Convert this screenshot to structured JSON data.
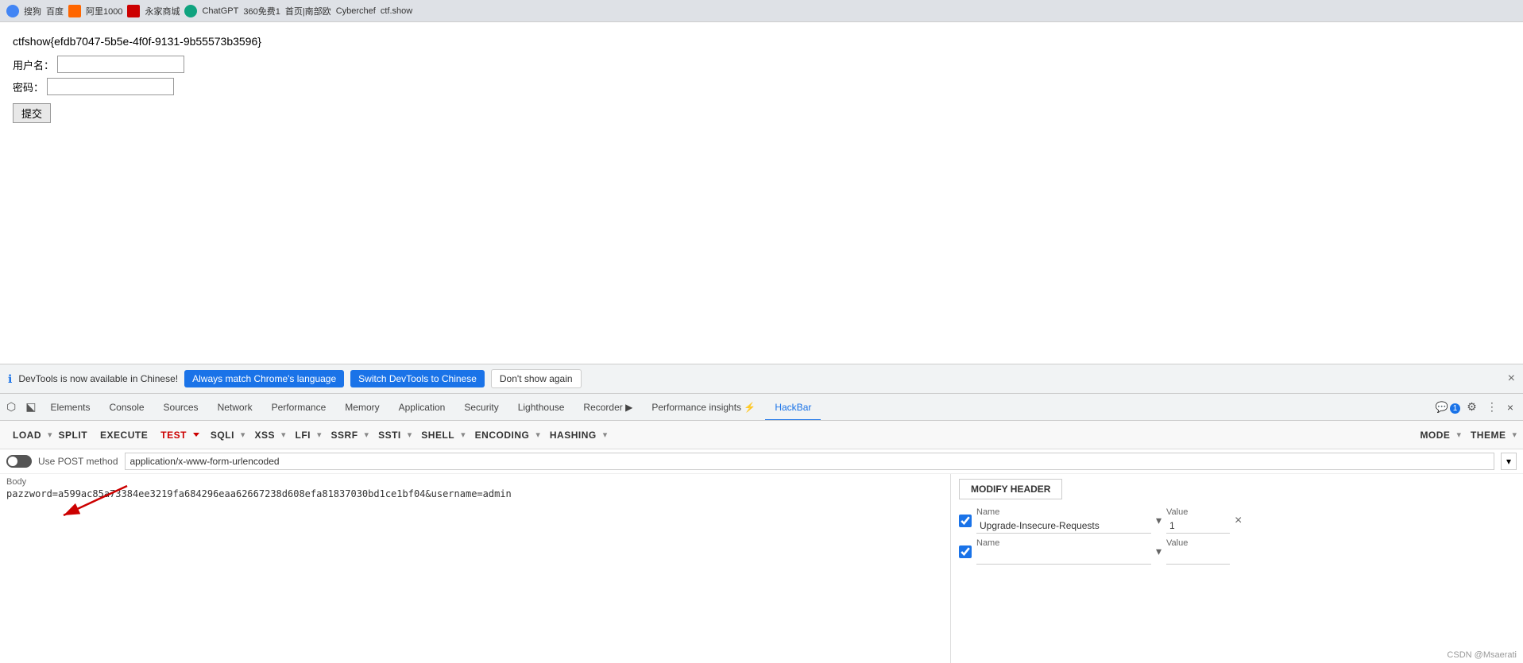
{
  "browser": {
    "topbar_items": [
      "搜狗",
      "百度",
      "阿里1000",
      "永家商城",
      "ChatGPT",
      "360免费1",
      "首页|南部欧",
      "Cyberchef",
      "ctf.show"
    ]
  },
  "page": {
    "ctf_flag": "ctfshow{efdb7047-5b5e-4f0f-9131-9b55573b3596}",
    "username_label": "用户名：",
    "password_label": "密码：",
    "submit_label": "提交"
  },
  "devtools_notification": {
    "icon": "ℹ",
    "message": "DevTools is now available in Chinese!",
    "btn1": "Always match Chrome's language",
    "btn2": "Switch DevTools to Chinese",
    "btn3": "Don't show again",
    "close": "×"
  },
  "devtools": {
    "tabs": [
      {
        "label": "Elements",
        "active": false
      },
      {
        "label": "Console",
        "active": false
      },
      {
        "label": "Sources",
        "active": false
      },
      {
        "label": "Network",
        "active": false
      },
      {
        "label": "Performance",
        "active": false
      },
      {
        "label": "Memory",
        "active": false
      },
      {
        "label": "Application",
        "active": false
      },
      {
        "label": "Security",
        "active": false
      },
      {
        "label": "Lighthouse",
        "active": false
      },
      {
        "label": "Recorder ▶",
        "active": false
      },
      {
        "label": "Performance insights ⚡",
        "active": false
      },
      {
        "label": "HackBar",
        "active": true
      }
    ],
    "notification_count": "1",
    "icons": {
      "inspect": "⬡",
      "device": "⬕",
      "gear": "⚙",
      "overflow": "⋮",
      "close": "×"
    }
  },
  "hackbar": {
    "buttons": [
      {
        "label": "LOAD",
        "has_dropdown": true
      },
      {
        "label": "SPLIT",
        "has_dropdown": false
      },
      {
        "label": "EXECUTE",
        "has_dropdown": false
      },
      {
        "label": "TEST",
        "has_dropdown": true,
        "red": true
      },
      {
        "label": "SQLI",
        "has_dropdown": true
      },
      {
        "label": "XSS",
        "has_dropdown": true
      },
      {
        "label": "LFI",
        "has_dropdown": true
      },
      {
        "label": "SSRF",
        "has_dropdown": true
      },
      {
        "label": "SSTI",
        "has_dropdown": true
      },
      {
        "label": "SHELL",
        "has_dropdown": true
      },
      {
        "label": "ENCODING",
        "has_dropdown": true
      },
      {
        "label": "HASHING",
        "has_dropdown": true
      },
      {
        "label": "MODE",
        "has_dropdown": true
      },
      {
        "label": "THEME",
        "has_dropdown": true
      }
    ],
    "url_row": {
      "toggle_label": "Use POST method",
      "url_value": "application/x-www-form-urlencoded"
    },
    "body": {
      "label": "Body",
      "content": "pazzword=a599ac85a73384ee3219fa684296eaa62667238d608efa81837030bd1ce1bf04&username=admin"
    },
    "modify_header_btn": "MODIFY HEADER",
    "headers": [
      {
        "checked": true,
        "name_label": "Name",
        "name_value": "Upgrade-Insecure-Requests",
        "value_label": "Value",
        "value_value": "1"
      },
      {
        "checked": true,
        "name_label": "Name",
        "name_value": "",
        "value_label": "Value",
        "value_value": ""
      }
    ]
  },
  "csdn_credit": "CSDN @Msaerati"
}
